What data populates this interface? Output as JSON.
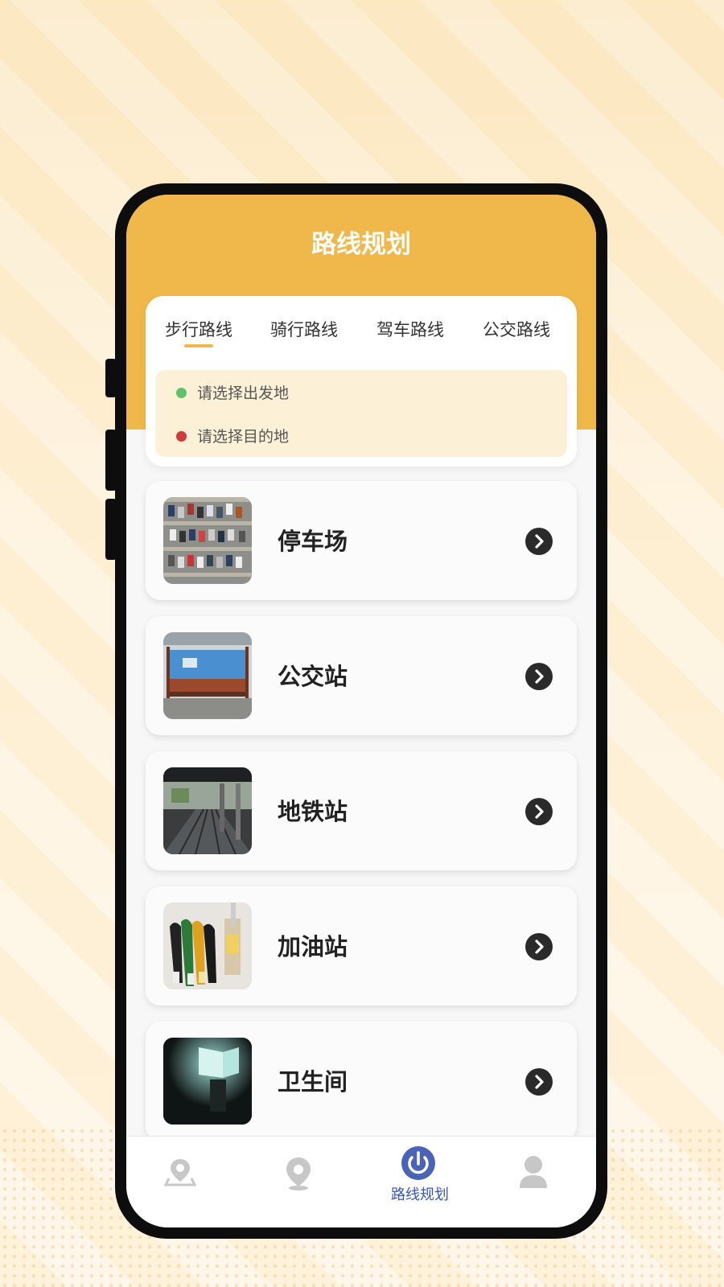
{
  "header": {
    "title": "路线规划"
  },
  "route_tabs": [
    {
      "label": "步行路线",
      "active": true
    },
    {
      "label": "骑行路线",
      "active": false
    },
    {
      "label": "驾车路线",
      "active": false
    },
    {
      "label": "公交路线",
      "active": false
    }
  ],
  "locations": {
    "origin_placeholder": "请选择出发地",
    "destination_placeholder": "请选择目的地"
  },
  "poi_list": [
    {
      "label": "停车场",
      "icon": "parking-lot-photo"
    },
    {
      "label": "公交站",
      "icon": "bus-stop-photo"
    },
    {
      "label": "地铁站",
      "icon": "subway-station-photo"
    },
    {
      "label": "加油站",
      "icon": "gas-station-photo"
    },
    {
      "label": "卫生间",
      "icon": "restroom-photo"
    }
  ],
  "bottom_nav": [
    {
      "icon": "map-pin-icon",
      "label": ""
    },
    {
      "icon": "location-icon",
      "label": ""
    },
    {
      "icon": "route-icon",
      "label": "路线规划",
      "active": true
    },
    {
      "icon": "user-icon",
      "label": ""
    }
  ],
  "colors": {
    "accent": "#f0b84a",
    "active_nav": "#4a63b8",
    "origin_dot": "#5dc26a",
    "destination_dot": "#d03a3a"
  }
}
